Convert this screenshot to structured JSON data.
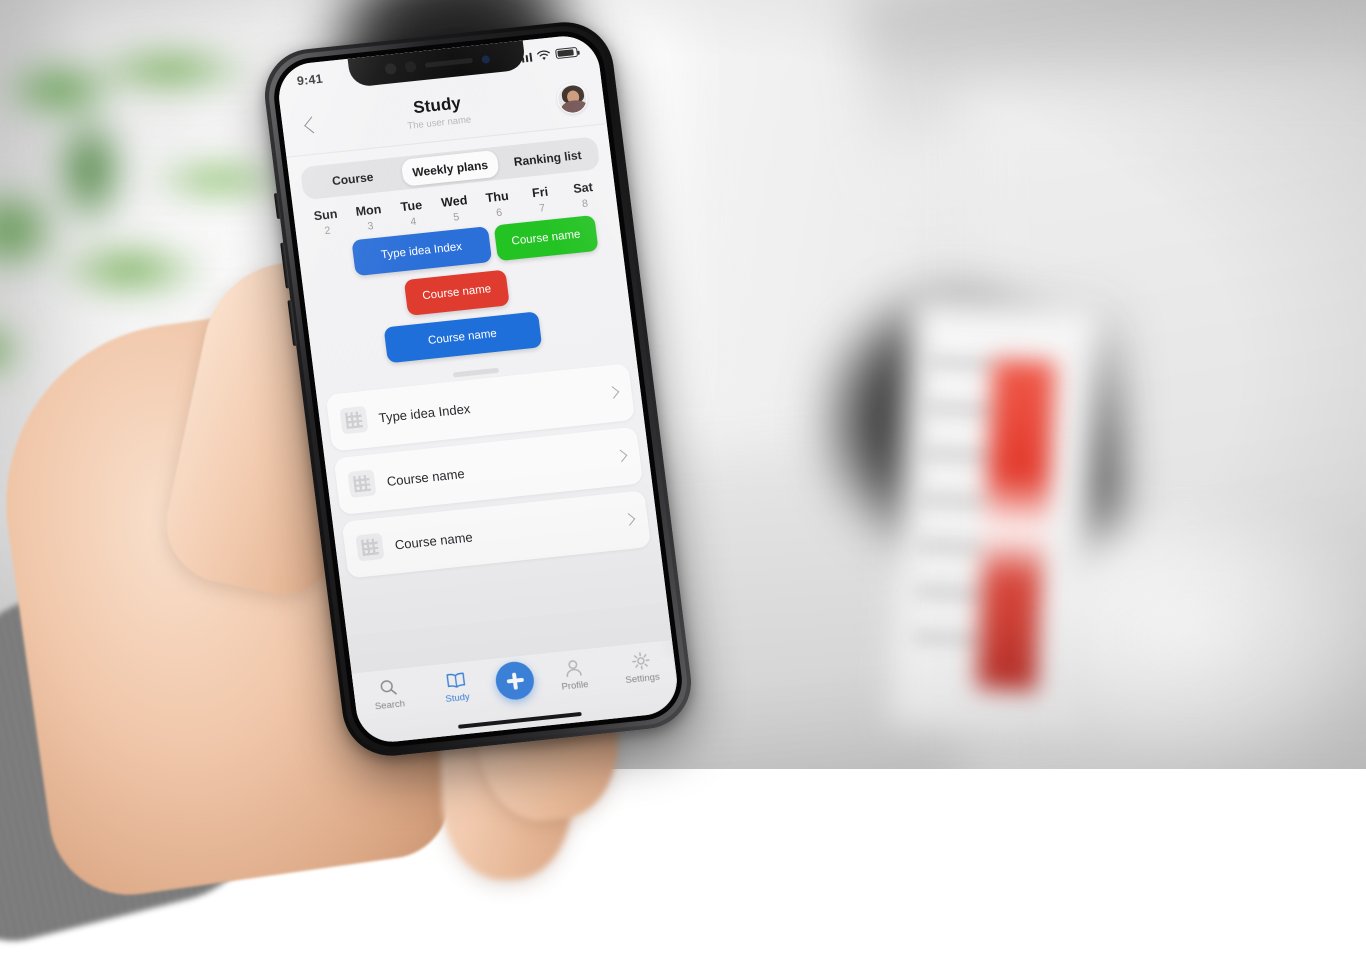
{
  "status_bar": {
    "time": "9:41",
    "signal_icon": "cellular-signal-icon",
    "wifi_icon": "wifi-icon",
    "battery_icon": "battery-icon"
  },
  "nav": {
    "back_icon": "chevron-left-icon",
    "title": "Study",
    "subtitle": "The user name",
    "avatar_name": "user-avatar"
  },
  "segmented": {
    "options": [
      {
        "label": "Course",
        "active": false
      },
      {
        "label": "Weekly plans",
        "active": true
      },
      {
        "label": "Ranking list",
        "active": false
      }
    ]
  },
  "week": {
    "days": [
      {
        "name": "Sun",
        "num": "2"
      },
      {
        "name": "Mon",
        "num": "3"
      },
      {
        "name": "Tue",
        "num": "4"
      },
      {
        "name": "Wed",
        "num": "5"
      },
      {
        "name": "Thu",
        "num": "6"
      },
      {
        "name": "Fri",
        "num": "7"
      },
      {
        "name": "Sat",
        "num": "8"
      }
    ]
  },
  "schedule_cards": [
    {
      "label": "Type idea Index",
      "color": "#2b6fd9",
      "left_pct": 14,
      "width_pct": 46
    },
    {
      "label": "Course name",
      "color": "#22c322",
      "left_pct": 62,
      "width_pct": 34
    },
    {
      "label": "Course name",
      "color": "#e03b2f",
      "left_pct": 30,
      "width_pct": 34
    },
    {
      "label": "Course name",
      "color": "#1e6fd9",
      "left_pct": 21,
      "width_pct": 52
    }
  ],
  "list": {
    "items": [
      {
        "icon": "grid-icon",
        "label": "Type idea Index",
        "chevron": "chevron-right-icon"
      },
      {
        "icon": "grid-icon",
        "label": "Course name",
        "chevron": "chevron-right-icon"
      },
      {
        "icon": "grid-icon",
        "label": "Course name",
        "chevron": "chevron-right-icon"
      }
    ]
  },
  "tabbar": {
    "items": [
      {
        "label": "Search",
        "icon": "search-icon",
        "active": false
      },
      {
        "label": "Study",
        "icon": "book-icon",
        "active": true
      },
      {
        "label": "Profile",
        "icon": "person-icon",
        "active": false
      },
      {
        "label": "Settings",
        "icon": "gear-icon",
        "active": false
      }
    ],
    "fab": {
      "icon": "plus-icon",
      "label": "Add"
    }
  },
  "theme": {
    "accent": "#3d85e0",
    "screen_bg": "#f2f2f4",
    "card_blue": "#2b6fd9",
    "card_green": "#22c322",
    "card_red": "#e03b2f",
    "muted_text": "#8e8e93"
  }
}
